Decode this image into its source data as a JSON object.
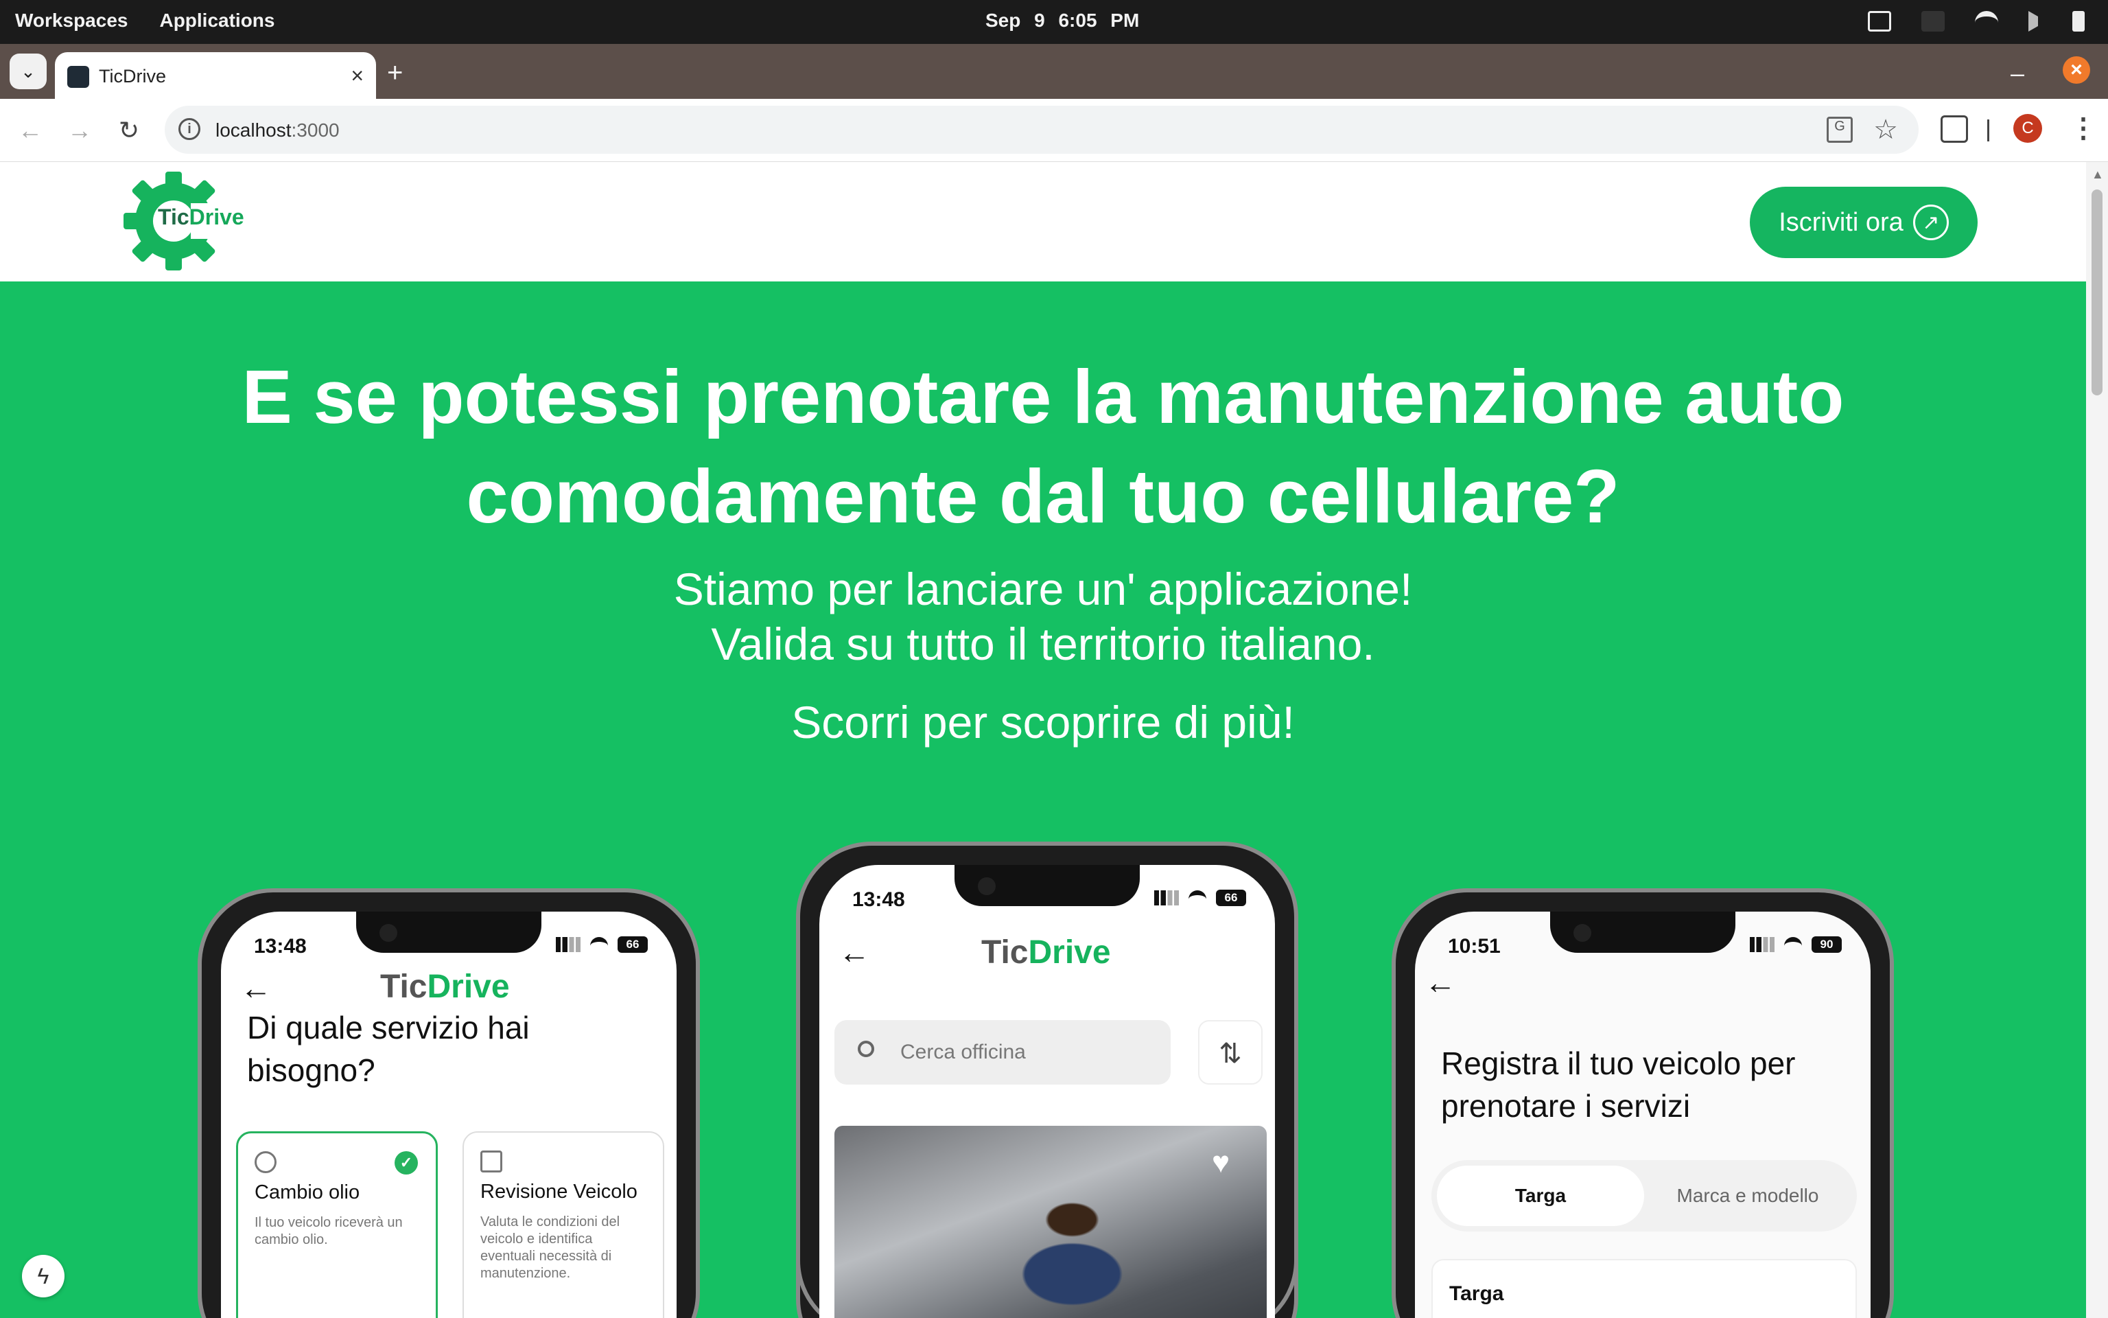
{
  "os": {
    "workspaces": "Workspaces",
    "applications": "Applications",
    "date": "Sep 9",
    "time": "6:05 PM"
  },
  "browser": {
    "tab_title": "TicDrive",
    "new_tab": "+",
    "close_tab": "×",
    "url_host": "localhost",
    "url_port": ":3000",
    "profile_initial": "C",
    "minimize": "–",
    "close_window": "×"
  },
  "site": {
    "logo_tic": "Tic",
    "logo_drive": "Drive",
    "cta_label": "Iscriviti ora",
    "hero_line1": "E se potessi prenotare la manutenzione auto",
    "hero_line2": "comodamente dal tuo cellulare?",
    "sub_line1": "Stiamo per lanciare un' applicazione!",
    "sub_line2": "Valida su tutto il territorio italiano.",
    "scroll_hint": "Scorri per scoprire di più!"
  },
  "phones": {
    "left": {
      "time": "13:48",
      "battery": "66",
      "brand_tic": "Tic",
      "brand_drive": "Drive",
      "question": "Di quale servizio hai bisogno?",
      "services": [
        {
          "title": "Cambio olio",
          "desc": "Il tuo veicolo riceverà un cambio olio.",
          "selected": true
        },
        {
          "title": "Revisione Veicolo",
          "desc": "Valuta le condizioni del veicolo e identifica eventuali necessità di manutenzione.",
          "selected": false
        }
      ]
    },
    "center": {
      "time": "13:48",
      "battery": "66",
      "brand_tic": "Tic",
      "brand_drive": "Drive",
      "search_placeholder": "Cerca officina"
    },
    "right": {
      "time": "10:51",
      "battery": "90",
      "heading": "Registra il tuo veicolo per prenotare i servizi",
      "segment_active": "Targa",
      "segment_inactive": "Marca e modello",
      "field_label": "Targa"
    }
  },
  "colors": {
    "brand_green": "#15c063",
    "cta_green": "#15b560",
    "check_green": "#26b35f"
  }
}
